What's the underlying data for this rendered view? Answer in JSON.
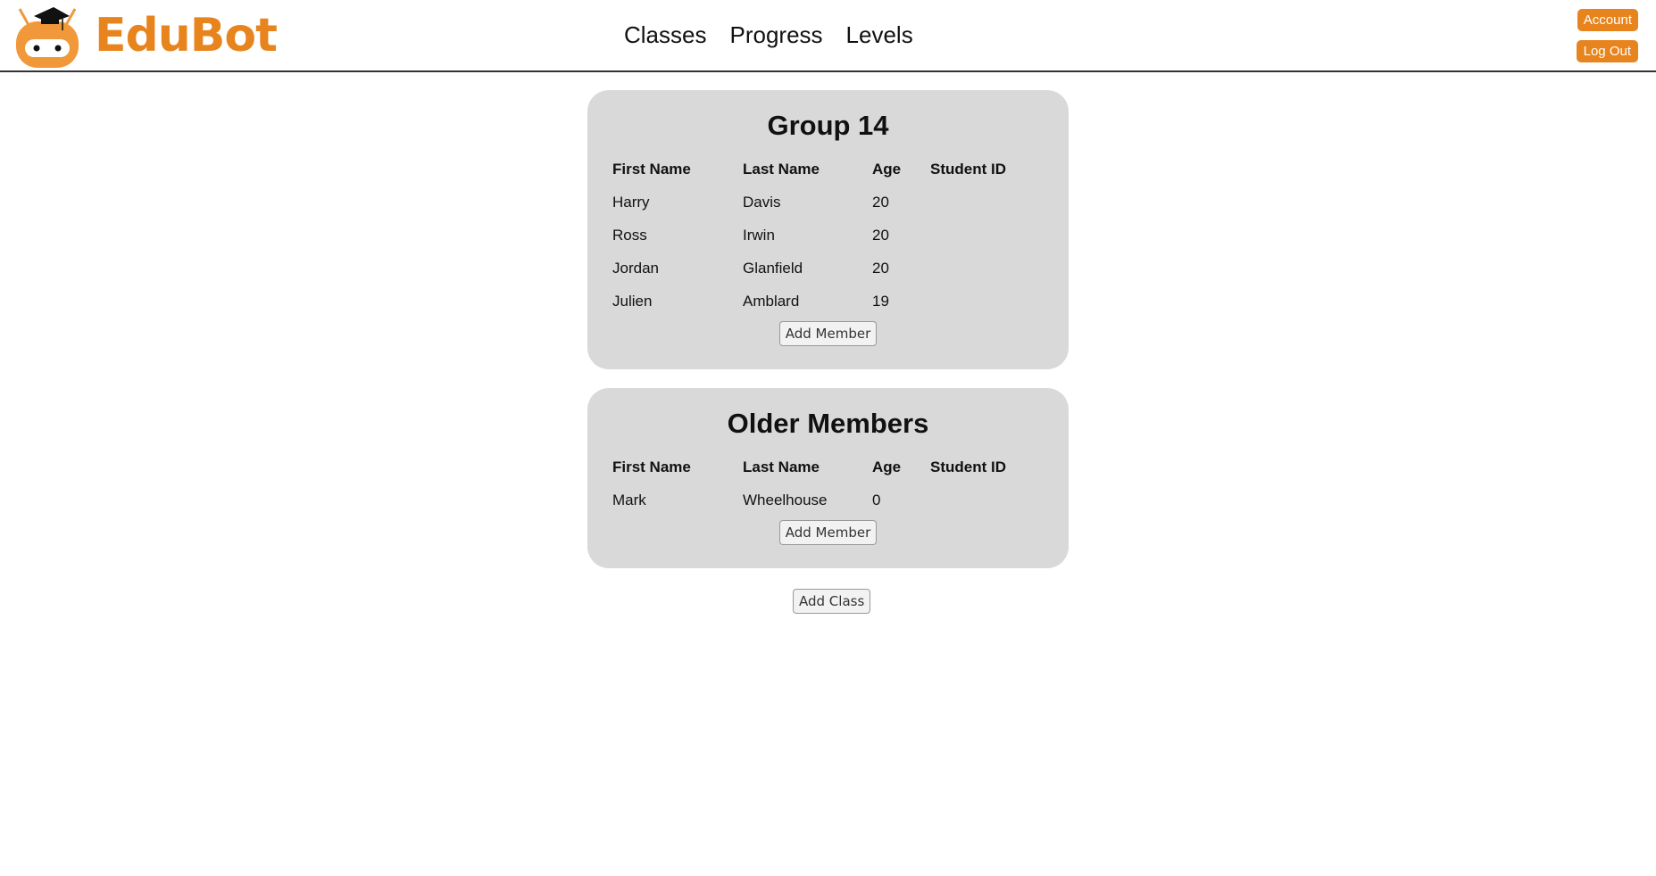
{
  "brand": "EduBot",
  "nav": [
    "Classes",
    "Progress",
    "Levels"
  ],
  "account_label": "Account",
  "logout_label": "Log Out",
  "columns": [
    "First Name",
    "Last Name",
    "Age",
    "Student ID"
  ],
  "groups": [
    {
      "title": "Group 14",
      "rows": [
        [
          "Harry",
          "Davis",
          "20",
          ""
        ],
        [
          "Ross",
          "Irwin",
          "20",
          ""
        ],
        [
          "Jordan",
          "Glanfield",
          "20",
          ""
        ],
        [
          "Julien",
          "Amblard",
          "19",
          ""
        ]
      ],
      "add_label": "Add Member"
    },
    {
      "title": "Older Members",
      "rows": [
        [
          "Mark",
          "Wheelhouse",
          "0",
          ""
        ]
      ],
      "add_label": "Add Member"
    }
  ],
  "add_class_label": "Add Class",
  "colors": {
    "accent": "#e8841e",
    "card": "#d9d9d9"
  }
}
